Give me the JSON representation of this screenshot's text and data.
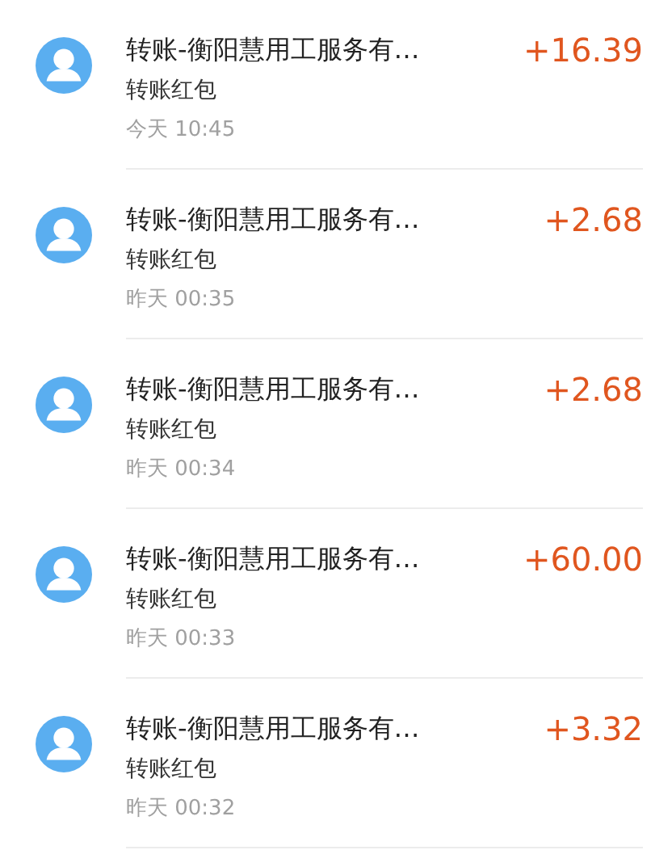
{
  "transactions": [
    {
      "title": "转账-衡阳慧用工服务有…",
      "subtitle": "转账红包",
      "time": "今天 10:45",
      "amount": "+16.39"
    },
    {
      "title": "转账-衡阳慧用工服务有…",
      "subtitle": "转账红包",
      "time": "昨天 00:35",
      "amount": "+2.68"
    },
    {
      "title": "转账-衡阳慧用工服务有…",
      "subtitle": "转账红包",
      "time": "昨天 00:34",
      "amount": "+2.68"
    },
    {
      "title": "转账-衡阳慧用工服务有…",
      "subtitle": "转账红包",
      "time": "昨天 00:33",
      "amount": "+60.00"
    },
    {
      "title": "转账-衡阳慧用工服务有…",
      "subtitle": "转账红包",
      "time": "昨天 00:32",
      "amount": "+3.32"
    }
  ]
}
